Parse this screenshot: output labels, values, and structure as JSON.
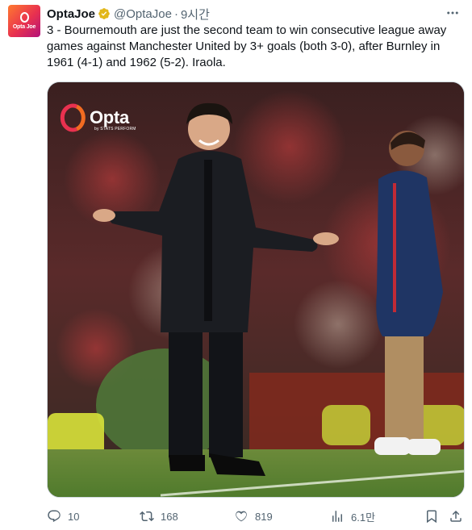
{
  "tweet": {
    "display_name": "OptaJoe",
    "verified": true,
    "handle": "@OptaJoe",
    "separator": "·",
    "time": "9시간",
    "text": "3 - Bournemouth are just the second team to win consecutive league away games against Manchester United by 3+ goals (both 3-0), after Burnley in 1961 (4-1) and 1962 (5-2). Iraola.",
    "avatar": {
      "logo_text": "Opta Joe",
      "colors": [
        "#ff7a2f",
        "#e8314f",
        "#b2127a"
      ]
    }
  },
  "media": {
    "brand": "Opta",
    "brand_sub": "by STATS PERFORM",
    "logo_colors": [
      "#f26b21",
      "#e8314f",
      "#a4126f"
    ]
  },
  "actions": {
    "reply": {
      "icon": "reply-icon",
      "count": "10"
    },
    "retweet": {
      "icon": "retweet-icon",
      "count": "168"
    },
    "like": {
      "icon": "heart-icon",
      "count": "819"
    },
    "views": {
      "icon": "views-chart-icon",
      "count": "6.1만"
    },
    "bookmark": {
      "icon": "bookmark-icon"
    },
    "share": {
      "icon": "share-icon"
    }
  },
  "colors": {
    "text_primary": "#0f1419",
    "text_secondary": "#536471",
    "verified_badge": "#e2b719"
  }
}
